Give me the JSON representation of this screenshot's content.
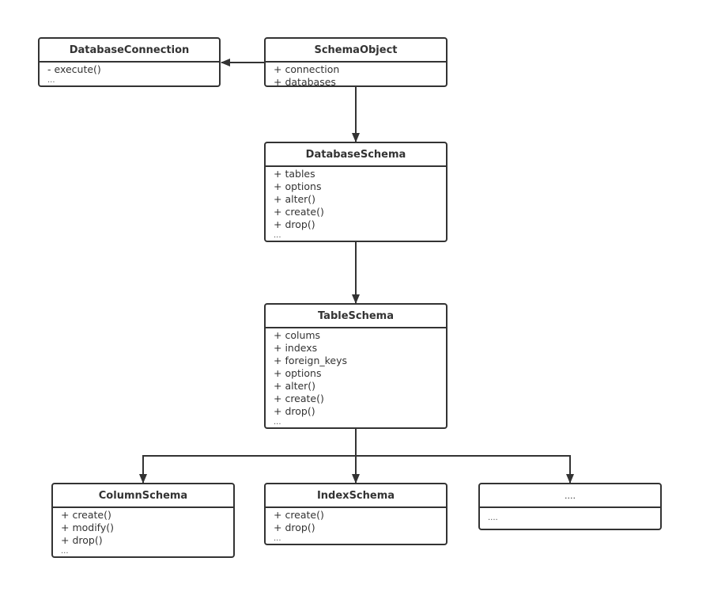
{
  "diagram": {
    "type": "uml-class-diagram",
    "colors": {
      "stroke": "#333333",
      "text": "#333333",
      "background": "#ffffff"
    },
    "classes": [
      {
        "id": "database-connection",
        "name": "DatabaseConnection",
        "members": [
          "- execute()"
        ],
        "more": "..."
      },
      {
        "id": "schema-object",
        "name": "SchemaObject",
        "members": [
          "+ connection",
          "+ databases"
        ],
        "more": ""
      },
      {
        "id": "database-schema",
        "name": "DatabaseSchema",
        "members": [
          "+ tables",
          "+ options",
          "+ alter()",
          "+ create()",
          "+ drop()"
        ],
        "more": "..."
      },
      {
        "id": "table-schema",
        "name": "TableSchema",
        "members": [
          "+ colums",
          "+ indexs",
          "+ foreign_keys",
          "+ options",
          "+ alter()",
          "+ create()",
          "+ drop()"
        ],
        "more": "..."
      },
      {
        "id": "column-schema",
        "name": "ColumnSchema",
        "members": [
          "+ create()",
          "+ modify()",
          "+ drop()"
        ],
        "more": "..."
      },
      {
        "id": "index-schema",
        "name": "IndexSchema",
        "members": [
          "+ create()",
          "+ drop()"
        ],
        "more": "..."
      },
      {
        "id": "other-schema",
        "name": "....",
        "members": [],
        "more": "...."
      }
    ],
    "relationships": [
      {
        "from": "SchemaObject",
        "to": "DatabaseConnection",
        "type": "association-arrow"
      },
      {
        "from": "SchemaObject",
        "to": "DatabaseSchema",
        "type": "association-arrow"
      },
      {
        "from": "DatabaseSchema",
        "to": "TableSchema",
        "type": "association-arrow"
      },
      {
        "from": "TableSchema",
        "to": "ColumnSchema",
        "type": "association-arrow"
      },
      {
        "from": "TableSchema",
        "to": "IndexSchema",
        "type": "association-arrow"
      },
      {
        "from": "TableSchema",
        "to": "....",
        "type": "association-arrow"
      }
    ]
  }
}
